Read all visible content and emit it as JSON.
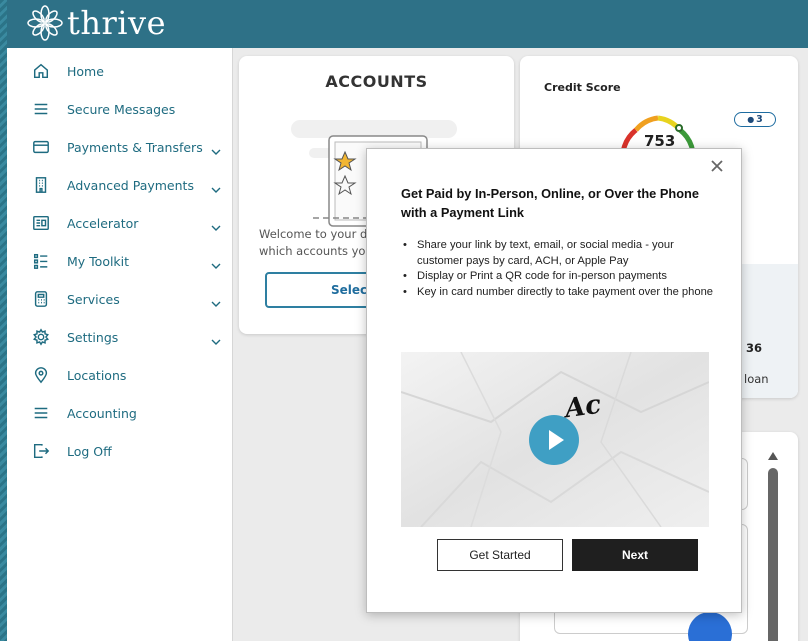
{
  "header": {
    "logo_text": "thrive",
    "brand_color": "#2e7187"
  },
  "sidebar": {
    "items": [
      {
        "label": "Home",
        "icon": "home-icon",
        "has_chevron": false
      },
      {
        "label": "Secure Messages",
        "icon": "menu-lines-icon",
        "has_chevron": false
      },
      {
        "label": "Payments & Transfers",
        "icon": "card-icon",
        "has_chevron": true
      },
      {
        "label": "Advanced Payments",
        "icon": "building-icon",
        "has_chevron": true
      },
      {
        "label": "Accelerator",
        "icon": "dashboard-icon",
        "has_chevron": true
      },
      {
        "label": "My Toolkit",
        "icon": "checklist-icon",
        "has_chevron": true
      },
      {
        "label": "Services",
        "icon": "calculator-icon",
        "has_chevron": true
      },
      {
        "label": "Settings",
        "icon": "gear-icon",
        "has_chevron": true
      },
      {
        "label": "Locations",
        "icon": "map-pin-icon",
        "has_chevron": false
      },
      {
        "label": "Accounting",
        "icon": "menu-lines-icon",
        "has_chevron": false
      },
      {
        "label": "Log Off",
        "icon": "logout-icon",
        "has_chevron": false
      }
    ]
  },
  "accounts": {
    "title": "ACCOUNTS",
    "welcome_line1": "Welcome to your da",
    "welcome_line2": "which accounts you",
    "select_label": "Select"
  },
  "credit": {
    "title": "Credit Score",
    "score": "753",
    "badge_count": "3",
    "partial_number": "36",
    "partial_text": "loan"
  },
  "modal": {
    "title": "Get Paid by In-Person, Online, or Over the Phone with a Payment Link",
    "bullets": [
      "Share your link by text, email, or social media - your customer pays by card, ACH, or Apple Pay",
      "Display or Print a QR code for in-person payments",
      "Key in card number directly to take payment over the phone"
    ],
    "video_overlay_text": "Ac",
    "get_started_label": "Get Started",
    "next_label": "Next"
  }
}
